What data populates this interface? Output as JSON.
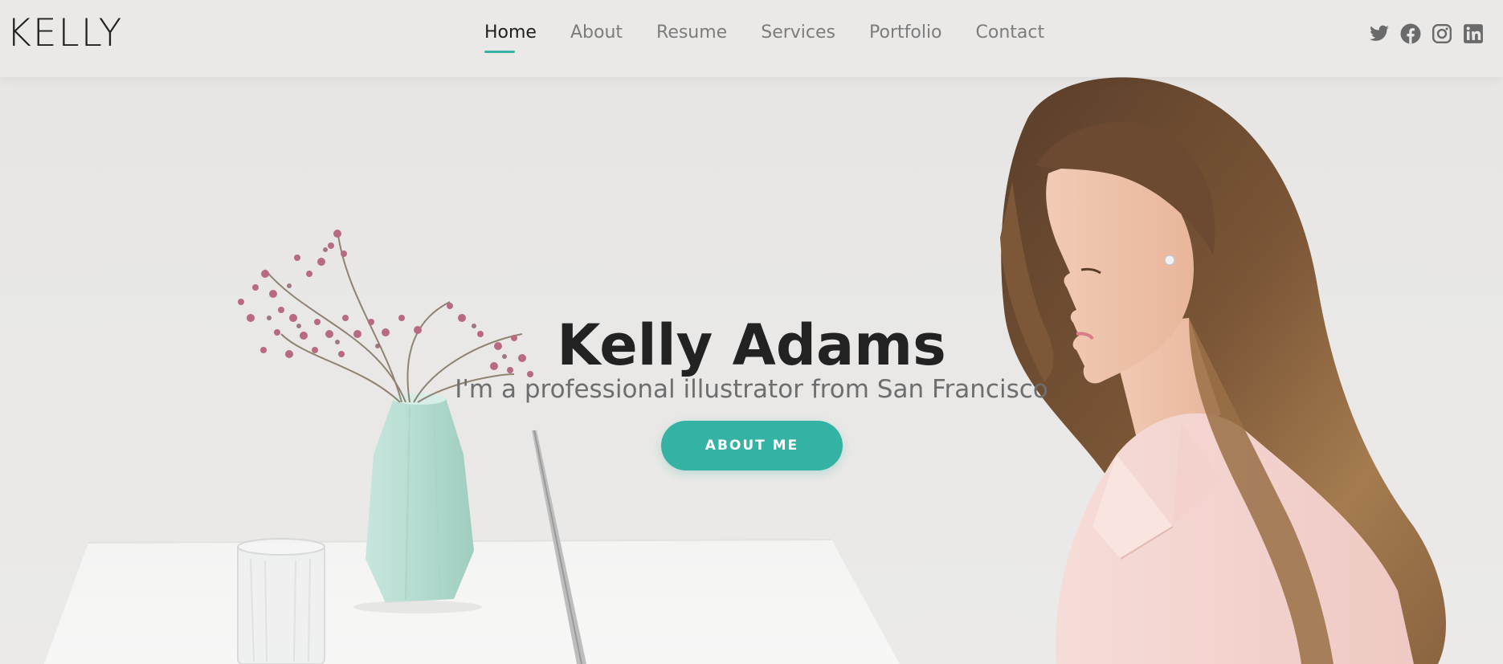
{
  "header": {
    "logo": "KELLY",
    "nav": [
      {
        "label": "Home",
        "active": true
      },
      {
        "label": "About",
        "active": false
      },
      {
        "label": "Resume",
        "active": false
      },
      {
        "label": "Services",
        "active": false
      },
      {
        "label": "Portfolio",
        "active": false
      },
      {
        "label": "Contact",
        "active": false
      }
    ],
    "socials": [
      "twitter-icon",
      "facebook-icon",
      "instagram-icon",
      "linkedin-icon"
    ]
  },
  "hero": {
    "title": "Kelly Adams",
    "subtitle": "I'm a professional illustrator from San Francisco",
    "button_label": "ABOUT ME"
  },
  "colors": {
    "accent": "#34b3a4",
    "header_bg": "#eae9e7",
    "text_dark": "#222222",
    "text_muted": "#7c7c7c"
  }
}
